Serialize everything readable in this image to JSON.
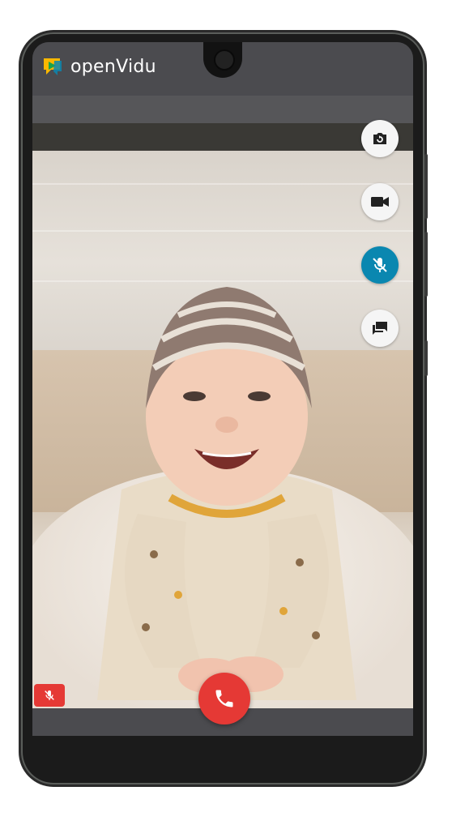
{
  "app": {
    "logo_text": "openVidu"
  },
  "controls": {
    "switch_camera": {
      "icon": "switch-camera-icon"
    },
    "camera": {
      "icon": "videocam-icon"
    },
    "microphone": {
      "icon": "mic-off-icon",
      "state": "muted",
      "accent": "#0a87b0"
    },
    "chat": {
      "icon": "chat-icon"
    }
  },
  "call": {
    "hangup_icon": "phone-icon",
    "hangup_color": "#e53935"
  },
  "participant": {
    "audio_muted_icon": "mic-off-icon",
    "badge_color": "#e53935"
  }
}
